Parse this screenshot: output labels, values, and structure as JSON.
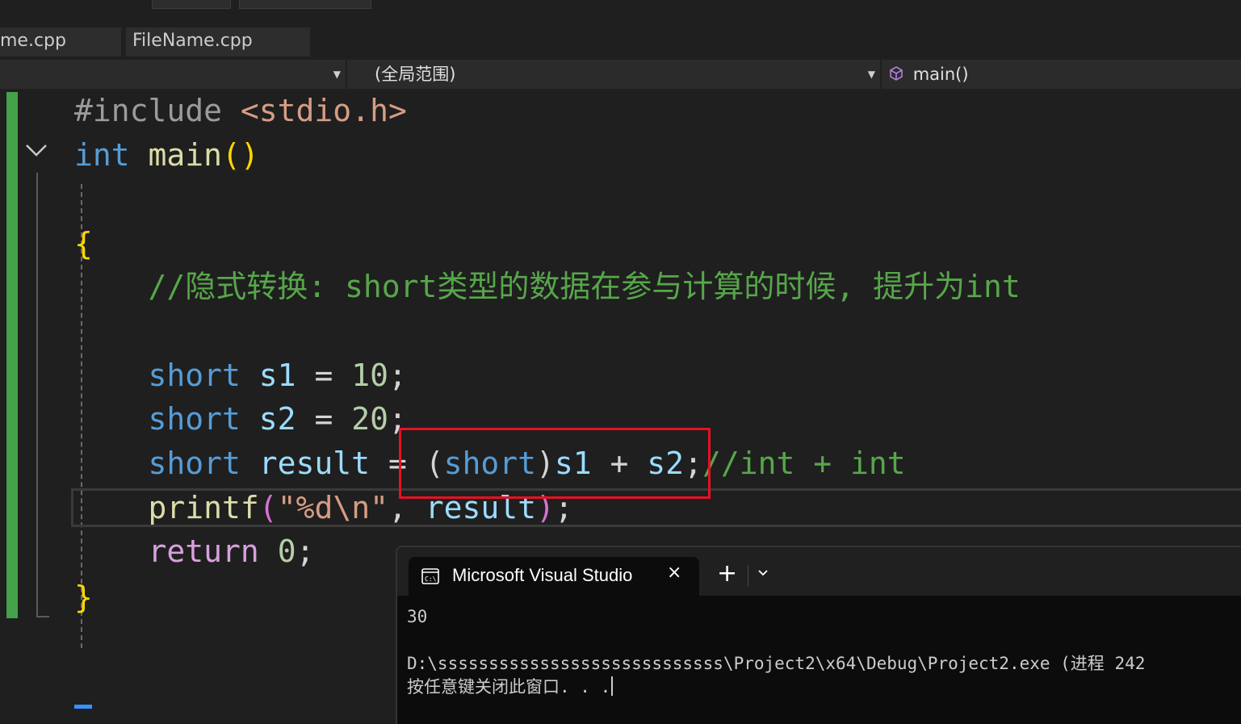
{
  "tabs": [
    {
      "label": "me.cpp"
    },
    {
      "label": "FileName.cpp"
    }
  ],
  "navbar": {
    "scope_label": "(全局范围)",
    "function_label": "main()",
    "function_icon": "cube-icon"
  },
  "code": {
    "include_directive": "#include",
    "include_header": "<stdio.h>",
    "kw_int": "int",
    "fn_main": "main",
    "open_brace": "{",
    "close_brace": "}",
    "comment_1": "//隐式转换: short类型的数据在参与计算的时候, 提升为int",
    "kw_short": "short",
    "var_s1": "s1",
    "var_s2": "s2",
    "var_result": "result",
    "num_10": "10",
    "num_20": "20",
    "num_0": "0",
    "cast_short": "short",
    "comment_2": "//int + int",
    "fn_printf": "printf",
    "format_string": "\"%d\\n\"",
    "kw_return": "return"
  },
  "colors": {
    "keyword": "#569cd6",
    "control_keyword": "#d8a0df",
    "function": "#dcdcaa",
    "variable": "#9cdcfe",
    "number": "#b5cea8",
    "string": "#d69d85",
    "comment": "#57a64a",
    "annotation_box": "#e81123",
    "change_bar": "#45a04a"
  },
  "terminal": {
    "tab_title": "Microsoft Visual Studio",
    "tab_icon": "console-icon",
    "close_icon": "×",
    "new_tab_icon": "+",
    "dropdown_icon": "⌄",
    "output_value": "30",
    "exit_line": "D:\\ssssssssssssssssssssssssssss\\Project2\\x64\\Debug\\Project2.exe (进程 242",
    "prompt_line": "按任意键关闭此窗口. . ."
  }
}
